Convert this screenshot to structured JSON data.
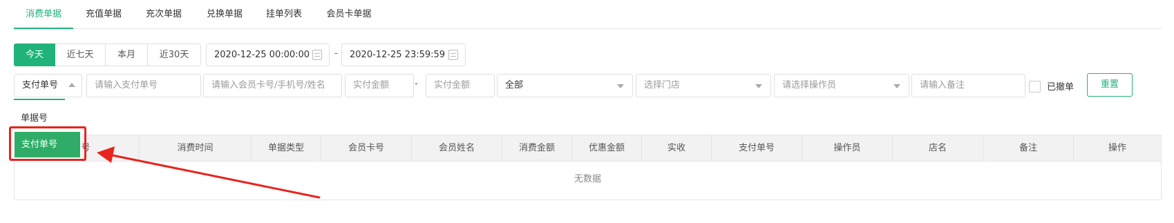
{
  "tabs": [
    {
      "label": "消费单据",
      "active": true
    },
    {
      "label": "充值单据",
      "active": false
    },
    {
      "label": "充次单据",
      "active": false
    },
    {
      "label": "兑换单据",
      "active": false
    },
    {
      "label": "挂单列表",
      "active": false
    },
    {
      "label": "会员卡单据",
      "active": false
    }
  ],
  "date_range_buttons": [
    {
      "label": "今天",
      "active": true
    },
    {
      "label": "近七天",
      "active": false
    },
    {
      "label": "本月",
      "active": false
    },
    {
      "label": "近30天",
      "active": false
    }
  ],
  "date_start": "2020-12-25 00:00:00",
  "date_end": "2020-12-25 23:59:59",
  "date_separator": "-",
  "filters": {
    "search_type": {
      "value": "支付单号",
      "options": [
        "单据号",
        "支付单号"
      ],
      "selected_index": 1
    },
    "payment_no_placeholder": "请输入支付单号",
    "member_placeholder": "请输入会员卡号/手机号/姓名",
    "amount_min_placeholder": "实付金额",
    "amount_separator": "-",
    "amount_max_placeholder": "实付金额",
    "type_value": "全部",
    "store_placeholder": "选择门店",
    "operator_placeholder": "请选择操作员",
    "remark_placeholder": "请输入备注",
    "revoked_label": "已撤单",
    "reset_label": "重置"
  },
  "table": {
    "columns": [
      "单据号",
      "消费时间",
      "单据类型",
      "会员卡号",
      "会员姓名",
      "消费金额",
      "优惠金额",
      "实收",
      "支付单号",
      "操作员",
      "店名",
      "备注",
      "操作"
    ],
    "empty_text": "无数据"
  },
  "colors": {
    "accent": "#1fb37a",
    "dropdown_selected": "#2fad68",
    "annotation_red": "#e8231d"
  }
}
